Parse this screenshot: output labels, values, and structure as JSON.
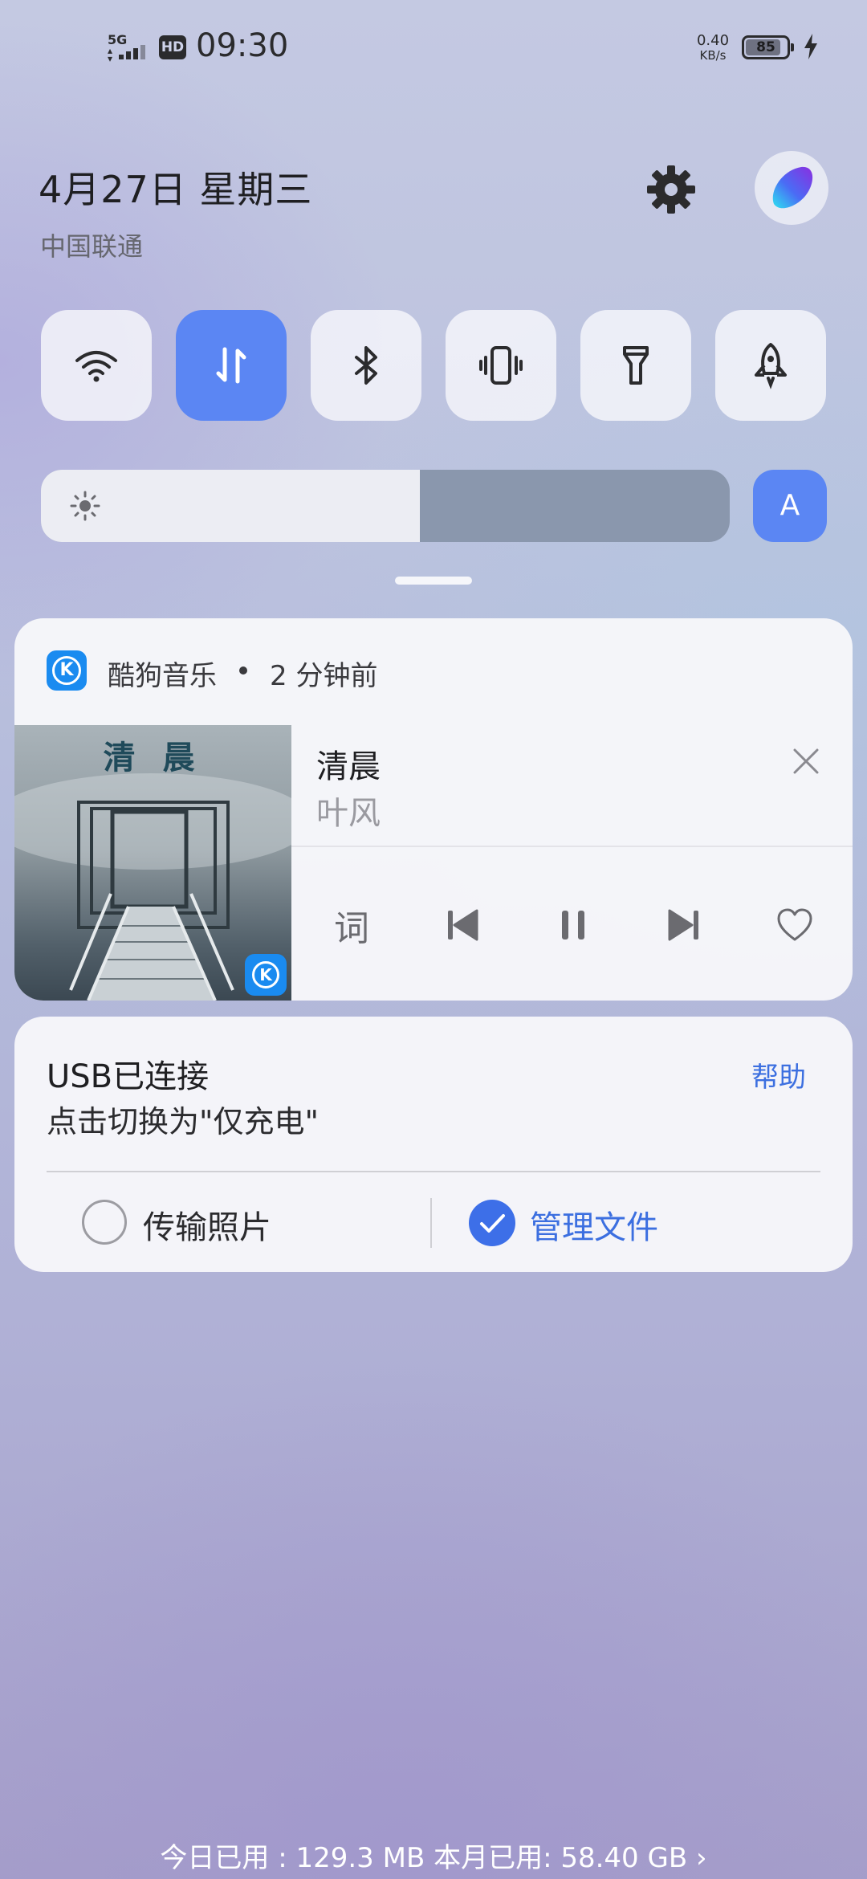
{
  "status_bar": {
    "network": "5G",
    "hd_badge": "HD",
    "time": "09:30",
    "speed_value": "0.40",
    "speed_unit": "KB/s",
    "battery_level": "85",
    "battery_fraction": 0.85,
    "charging": true
  },
  "header": {
    "date": "4月27日 星期三",
    "carrier": "中国联通",
    "settings_icon": "gear-icon"
  },
  "quick_tiles": [
    {
      "icon": "wifi-icon",
      "active": false
    },
    {
      "icon": "mobile-data-icon",
      "active": true
    },
    {
      "icon": "bluetooth-icon",
      "active": false
    },
    {
      "icon": "vibrate-icon",
      "active": false
    },
    {
      "icon": "flashlight-icon",
      "active": false
    },
    {
      "icon": "rocket-icon",
      "active": false
    }
  ],
  "brightness": {
    "level": 0.55,
    "auto_label": "A"
  },
  "music_notification": {
    "app_name": "酷狗音乐",
    "time_ago": "2 分钟前",
    "album_title": "清 晨",
    "song_title": "清晨",
    "artist": "叶风",
    "lyrics_label": "词",
    "accent": "#1a8bf0"
  },
  "usb_notification": {
    "title": "USB已连接",
    "subtitle": "点击切换为\"仅充电\"",
    "help_label": "帮助",
    "option_1": "传输照片",
    "option_2": "管理文件",
    "selected_option": 2,
    "accent": "#3c6fe0"
  },
  "footer": {
    "data_usage": "今日已用 : 129.3 MB 本月已用: 58.40 GB ›"
  }
}
